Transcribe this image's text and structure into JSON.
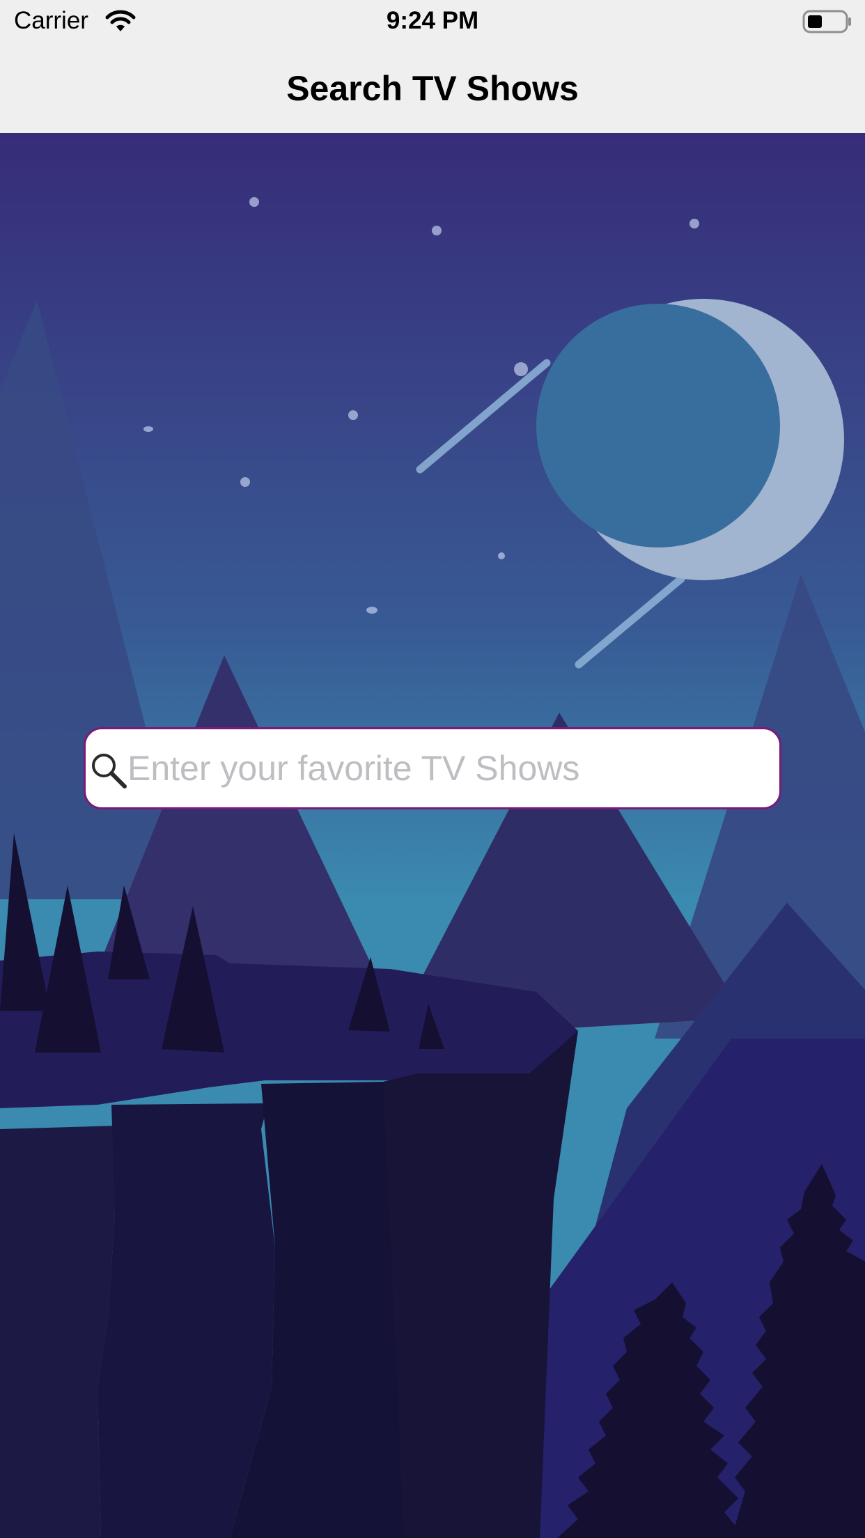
{
  "status_bar": {
    "carrier": "Carrier",
    "time": "9:24 PM",
    "wifi_icon": "wifi-icon",
    "battery_icon": "battery-icon"
  },
  "nav_bar": {
    "title": "Search TV Shows"
  },
  "search": {
    "placeholder": "Enter your favorite TV Shows",
    "value": "",
    "icon": "search-icon",
    "border_color": "#7a1a7a"
  },
  "background": {
    "description_icon": "night-mountain-illustration",
    "sky_top_color": "#372c79",
    "sky_bottom_color": "#3b8bb0",
    "moon_color": "#a1b4d0"
  }
}
